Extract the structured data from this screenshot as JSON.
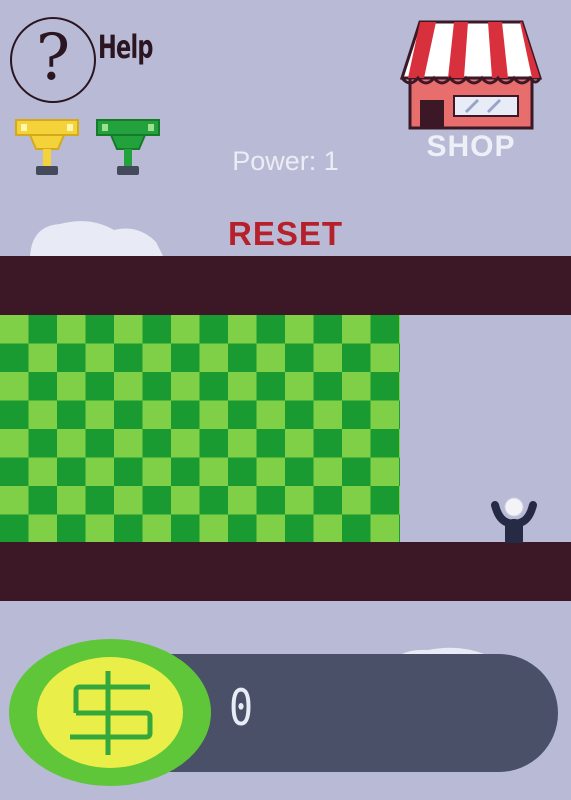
{
  "help": {
    "glyph": "?",
    "label": "Help"
  },
  "trophies": [
    {
      "icon": "gold-trophy-icon",
      "color": "#f4d23a"
    },
    {
      "icon": "green-trophy-icon",
      "color": "#22a13c"
    }
  ],
  "stats": {
    "power": "Power: 1"
  },
  "shop": {
    "label": "SHOP",
    "icon": "shop-storefront-icon"
  },
  "controls": {
    "reset_label": "RESET"
  },
  "playfield": {
    "wall_color": "#3c1827",
    "checker_colors": [
      "#1a9b32",
      "#7fd047"
    ],
    "player_icon": "stick-figure-arms-raised-icon"
  },
  "money": {
    "value": "0",
    "icon": "dollar-coin-icon"
  }
}
